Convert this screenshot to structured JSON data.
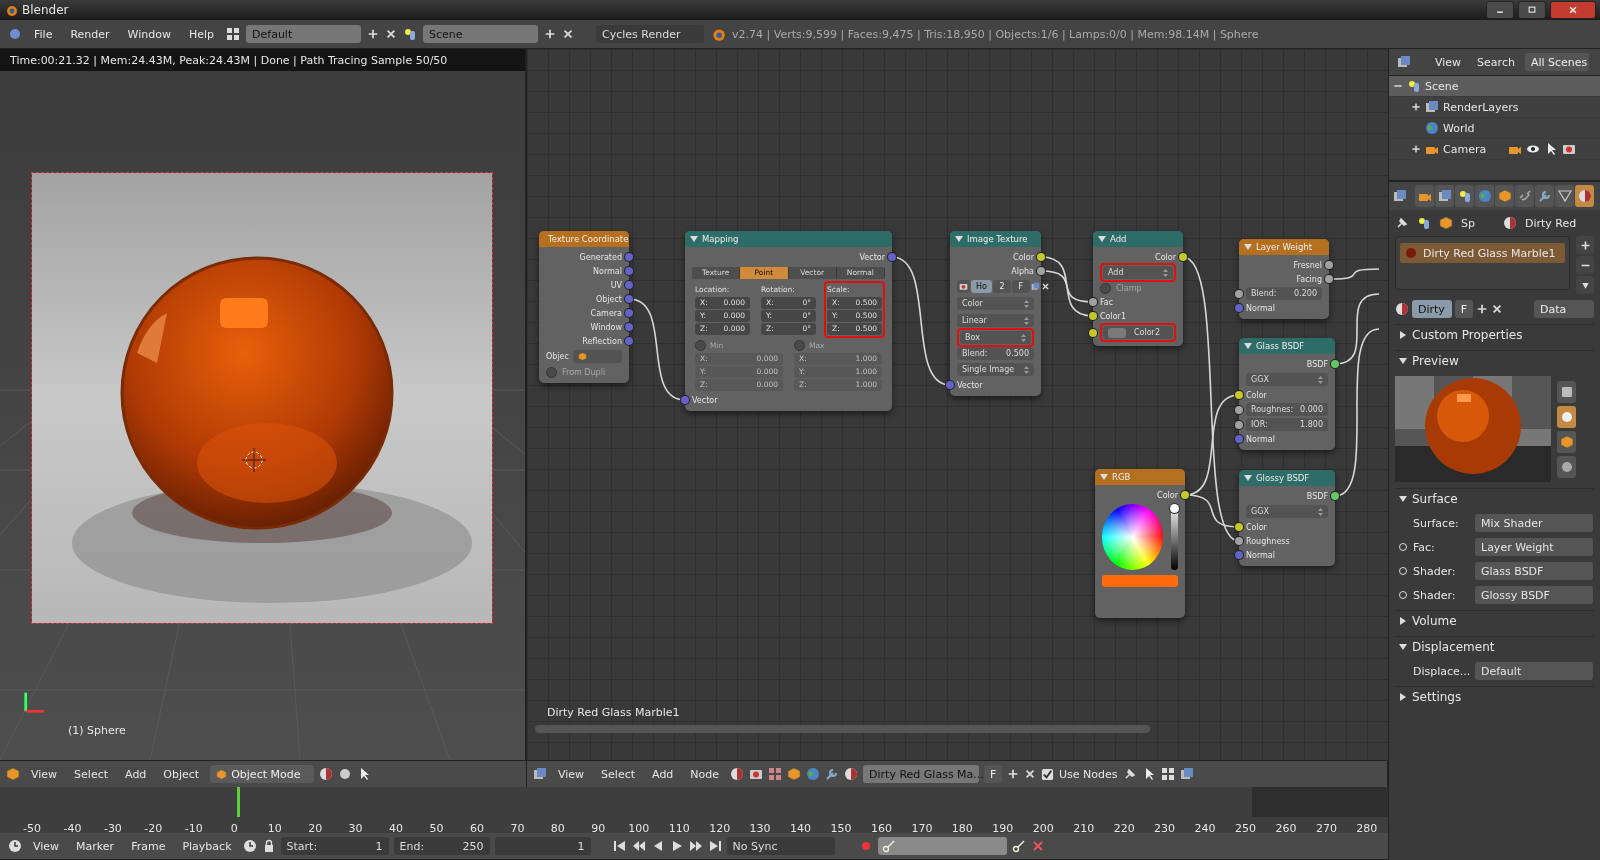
{
  "window": {
    "title": "Blender"
  },
  "menu_bar": {
    "menus": [
      "File",
      "Render",
      "Window",
      "Help"
    ],
    "layout": "Default",
    "scene": "Scene",
    "engine": "Cycles Render",
    "stats": "v2.74 | Verts:9,599 | Faces:9,475 | Tris:18,950 | Objects:1/6 | Lamps:0/0 | Mem:98.14M | Sphere"
  },
  "viewport": {
    "render_info": "Time:00:21.32 | Mem:24.43M, Peak:24.43M | Done | Path Tracing Sample 50/50",
    "object_label": "(1) Sphere",
    "header": {
      "menus": [
        "View",
        "Select",
        "Add",
        "Object"
      ],
      "mode": "Object Mode"
    }
  },
  "node_editor": {
    "material_label": "Dirty Red Glass Marble1",
    "nodes": [
      {
        "title": "Texture Coordinate",
        "color": "#b5701f",
        "rows": [
          {
            "kind": "out",
            "label": "Generated",
            "color": "#6363c7"
          },
          {
            "kind": "out",
            "label": "Normal",
            "color": "#6363c7"
          },
          {
            "kind": "out",
            "label": "UV",
            "color": "#6363c7"
          },
          {
            "kind": "out",
            "label": "Object",
            "color": "#6363c7"
          },
          {
            "kind": "out",
            "label": "Camera",
            "color": "#6363c7"
          },
          {
            "kind": "out",
            "label": "Window",
            "color": "#6363c7"
          },
          {
            "kind": "out",
            "label": "Reflection",
            "color": "#6363c7"
          },
          {
            "kind": "object",
            "label": "Objec"
          },
          {
            "kind": "check",
            "label": "From Dupli",
            "checked": false
          }
        ]
      },
      {
        "title": "Mapping",
        "color": "#2e6c68",
        "rows": [
          {
            "kind": "out",
            "label": "Vector",
            "color": "#6363c7"
          },
          {
            "kind": "tabs",
            "items": [
              {
                "label": "Texture",
                "selected": false
              },
              {
                "label": "Point",
                "selected": true
              },
              {
                "label": "Vector",
                "selected": false
              },
              {
                "label": "Normal",
                "selected": false
              }
            ]
          },
          {
            "kind": "xyz",
            "groups": [
              {
                "heading": "Location:",
                "highlighted": false,
                "disabled": false,
                "fields": [
                  {
                    "label": "X:",
                    "value": "0.000"
                  },
                  {
                    "label": "Y:",
                    "value": "0.000"
                  },
                  {
                    "label": "Z:",
                    "value": "0.000"
                  }
                ]
              },
              {
                "heading": "Rotation:",
                "highlighted": false,
                "disabled": false,
                "fields": [
                  {
                    "label": "X:",
                    "value": "0°"
                  },
                  {
                    "label": "Y:",
                    "value": "0°"
                  },
                  {
                    "label": "Z:",
                    "value": "0°"
                  }
                ]
              },
              {
                "heading": "Scale:",
                "highlighted": true,
                "disabled": false,
                "fields": [
                  {
                    "label": "X:",
                    "value": "0.500"
                  },
                  {
                    "label": "Y:",
                    "value": "0.500"
                  },
                  {
                    "label": "Z:",
                    "value": "0.500"
                  }
                ]
              }
            ]
          },
          {
            "kind": "xyz",
            "groups": [
              {
                "heading": "Min",
                "checked": false,
                "highlighted": false,
                "disabled": true,
                "fields": [
                  {
                    "label": "X:",
                    "value": "0.000"
                  },
                  {
                    "label": "Y:",
                    "value": "0.000"
                  },
                  {
                    "label": "Z:",
                    "value": "0.000"
                  }
                ]
              },
              {
                "heading": "Max",
                "checked": false,
                "highlighted": false,
                "disabled": true,
                "fields": [
                  {
                    "label": "X:",
                    "value": "1.000"
                  },
                  {
                    "label": "Y:",
                    "value": "1.000"
                  },
                  {
                    "label": "Z:",
                    "value": "1.000"
                  }
                ]
              }
            ]
          },
          {
            "kind": "in",
            "label": "Vector",
            "color": "#6363c7"
          }
        ]
      },
      {
        "title": "Image Texture",
        "color": "#2e6c68",
        "rows": [
          {
            "kind": "out",
            "label": "Color",
            "color": "#c7c729"
          },
          {
            "kind": "out",
            "label": "Alpha",
            "color": "#a1a1a1"
          },
          {
            "kind": "imagebar",
            "name": "Ho",
            "users": "2",
            "fake_user": "F"
          },
          {
            "kind": "select",
            "label": "Color",
            "highlighted": false
          },
          {
            "kind": "select",
            "label": "Linear",
            "highlighted": false
          },
          {
            "kind": "select",
            "label": "Box",
            "highlighted": true
          },
          {
            "kind": "field",
            "label": "Blend:",
            "value": "0.500"
          },
          {
            "kind": "select",
            "label": "Single Image",
            "highlighted": false
          },
          {
            "kind": "in",
            "label": "Vector",
            "color": "#6363c7"
          }
        ]
      },
      {
        "title": "Add",
        "color": "#2e6c68",
        "rows": [
          {
            "kind": "out",
            "label": "Color",
            "color": "#c7c729"
          },
          {
            "kind": "select",
            "label": "Add",
            "highlighted": true
          },
          {
            "kind": "check",
            "label": "Clamp",
            "checked": false
          },
          {
            "kind": "in",
            "label": "Fac",
            "color": "#a1a1a1"
          },
          {
            "kind": "in",
            "label": "Color1",
            "color": "#c7c729"
          },
          {
            "kind": "colorin",
            "label": "Color2",
            "color": "#c7c729",
            "highlighted": true
          }
        ]
      },
      {
        "title": "Layer Weight",
        "color": "#b5701f",
        "rows": [
          {
            "kind": "out",
            "label": "Fresnel",
            "color": "#a1a1a1"
          },
          {
            "kind": "out",
            "label": "Facing",
            "color": "#a1a1a1"
          },
          {
            "kind": "field",
            "label": "Blend:",
            "value": "0.200",
            "color": "#a1a1a1"
          },
          {
            "kind": "in",
            "label": "Normal",
            "color": "#6363c7"
          }
        ]
      },
      {
        "title": "Glass BSDF",
        "color": "#2e6c68",
        "rows": [
          {
            "kind": "out",
            "label": "BSDF",
            "color": "#63c763"
          },
          {
            "kind": "select",
            "label": "GGX",
            "highlighted": false
          },
          {
            "kind": "in",
            "label": "Color",
            "color": "#c7c729"
          },
          {
            "kind": "field",
            "label": "Roughnes:",
            "value": "0.000",
            "color": "#a1a1a1"
          },
          {
            "kind": "field",
            "label": "IOR:",
            "value": "1.800",
            "color": "#a1a1a1"
          },
          {
            "kind": "in",
            "label": "Normal",
            "color": "#6363c7"
          }
        ]
      },
      {
        "title": "RGB",
        "color": "#b5701f",
        "rows": [
          {
            "kind": "out",
            "label": "Color",
            "color": "#c7c729"
          },
          {
            "kind": "wheel",
            "color": "#ff6a0a",
            "level": 1
          }
        ]
      },
      {
        "title": "Glossy BSDF",
        "color": "#2e6c68",
        "rows": [
          {
            "kind": "out",
            "label": "BSDF",
            "color": "#63c763"
          },
          {
            "kind": "select",
            "label": "GGX",
            "highlighted": false
          },
          {
            "kind": "in",
            "label": "Color",
            "color": "#c7c729"
          },
          {
            "kind": "in",
            "label": "Roughness",
            "color": "#a1a1a1"
          },
          {
            "kind": "in",
            "label": "Normal",
            "color": "#6363c7"
          }
        ]
      }
    ],
    "header": {
      "menus": [
        "View",
        "Select",
        "Add",
        "Node"
      ],
      "material": "Dirty Red Glass Ma...",
      "fake_user": "F",
      "use_nodes": {
        "label": "Use Nodes",
        "checked": true
      }
    }
  },
  "outliner": {
    "menus": [
      "View",
      "Search"
    ],
    "filter": "All Scenes",
    "tree": [
      {
        "label": "Scene",
        "kind": "scene",
        "selected": true,
        "expanded": true,
        "children": [
          {
            "label": "RenderLayers",
            "kind": "renderlayers",
            "selected": false,
            "expanded": false
          },
          {
            "label": "World",
            "kind": "world",
            "selected": false
          },
          {
            "label": "Camera",
            "kind": "camera",
            "selected": false,
            "expanded": false
          }
        ]
      }
    ]
  },
  "properties": {
    "tabs": [
      {
        "kind": "render",
        "selected": false
      },
      {
        "kind": "layers",
        "selected": false
      },
      {
        "kind": "scene",
        "selected": false
      },
      {
        "kind": "world",
        "selected": false
      },
      {
        "kind": "object",
        "selected": false
      },
      {
        "kind": "constraints",
        "selected": false
      },
      {
        "kind": "modifiers",
        "selected": false
      },
      {
        "kind": "data",
        "selected": false
      },
      {
        "kind": "material",
        "selected": true
      }
    ],
    "breadcrumb": [
      "Sp",
      "Dirty Red"
    ],
    "slots": [
      {
        "label": "Dirty Red Glass Marble1",
        "selected": true
      }
    ],
    "datablock": {
      "name": "Dirty",
      "fake_user": "F",
      "link": "Data"
    },
    "panels": [
      {
        "title": "Custom Properties",
        "expanded": false
      },
      {
        "title": "Preview",
        "expanded": true,
        "kind": "preview"
      },
      {
        "title": "Surface",
        "expanded": true,
        "kind": "props",
        "rows": [
          {
            "label": "Surface:",
            "value": "Mix Shader",
            "linked": false
          },
          {
            "label": "Fac:",
            "value": "Layer Weight",
            "linked": true
          },
          {
            "label": "Shader:",
            "value": "Glass BSDF",
            "linked": true
          },
          {
            "label": "Shader:",
            "value": "Glossy BSDF",
            "linked": true
          }
        ]
      },
      {
        "title": "Volume",
        "expanded": false
      },
      {
        "title": "Displacement",
        "expanded": true,
        "kind": "props",
        "rows": [
          {
            "label": "Displace...",
            "value": "Default",
            "linked": false
          }
        ]
      },
      {
        "title": "Settings",
        "expanded": false
      }
    ]
  },
  "timeline": {
    "ticks": [
      "-50",
      "-40",
      "-30",
      "-20",
      "-10",
      "0",
      "10",
      "20",
      "30",
      "40",
      "50",
      "60",
      "70",
      "80",
      "90",
      "100",
      "110",
      "120",
      "130",
      "140",
      "150",
      "160",
      "170",
      "180",
      "190",
      "200",
      "210",
      "220",
      "230",
      "240",
      "250",
      "260",
      "270",
      "280"
    ],
    "playhead": {
      "level": 0.171
    },
    "header": {
      "menus": [
        "View",
        "Marker",
        "Frame",
        "Playback"
      ],
      "start_label": "Start:",
      "start": "1",
      "end_label": "End:",
      "end": "250",
      "frame": "1",
      "sync": "No Sync"
    }
  }
}
